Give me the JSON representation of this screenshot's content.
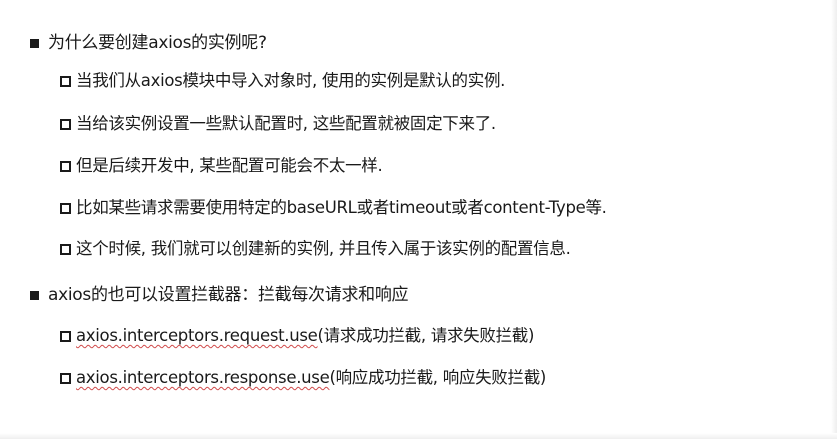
{
  "slide": {
    "heading_why": "为什么要创建axios的实例呢?",
    "why_items": [
      "当我们从axios模块中导入对象时, 使用的实例是默认的实例.",
      "当给该实例设置一些默认配置时, 这些配置就被固定下来了.",
      "但是后续开发中, 某些配置可能会不太一样.",
      "比如某些请求需要使用特定的baseURL或者timeout或者content-Type等.",
      "这个时候, 我们就可以创建新的实例, 并且传入属于该实例的配置信息."
    ],
    "heading_interceptors": "axios的也可以设置拦截器：拦截每次请求和响应",
    "interceptor_items": [
      {
        "code": "axios.interceptors.request.use",
        "desc": "(请求成功拦截, 请求失败拦截)"
      },
      {
        "code": "axios.interceptors.response.use",
        "desc": "(响应成功拦截, 响应失败拦截)"
      }
    ]
  }
}
